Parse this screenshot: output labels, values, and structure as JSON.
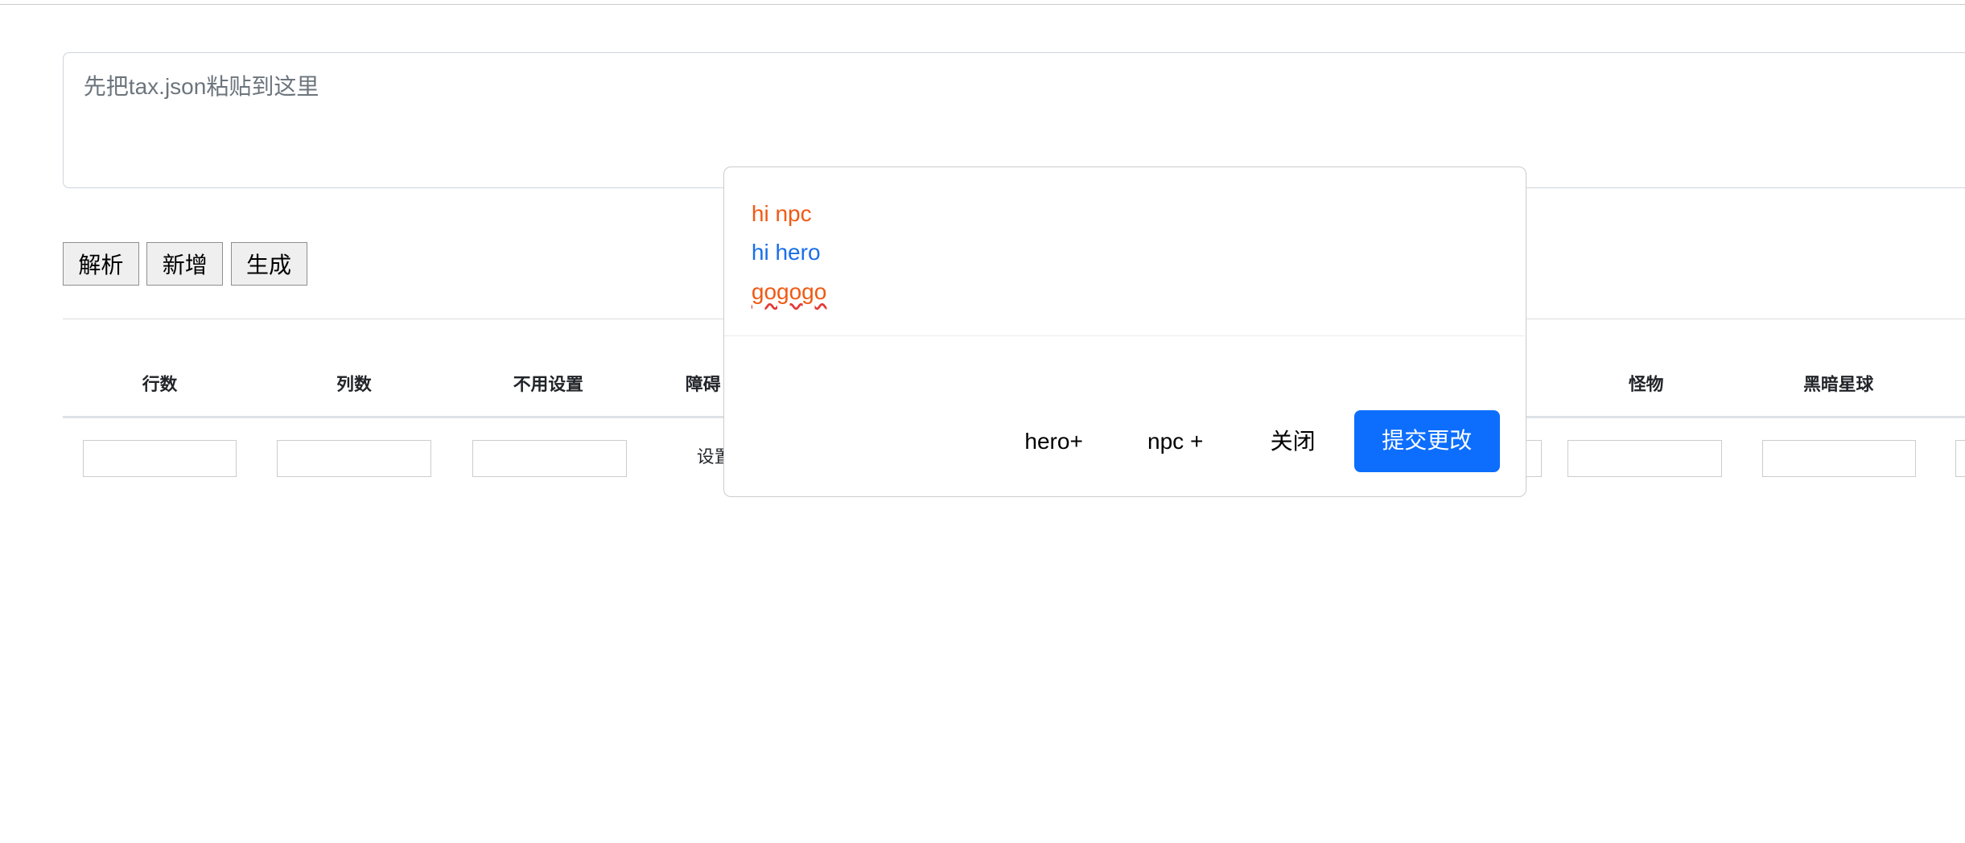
{
  "editor": {
    "placeholder": "先把tax.json粘贴到这里"
  },
  "toolbar": {
    "parse": "解析",
    "add": "新增",
    "generate": "生成"
  },
  "table": {
    "headers": [
      "行数",
      "列数",
      "不用设置",
      "障碍",
      "怪物",
      "黑暗星球"
    ],
    "row": {
      "obstacle_action": "设置"
    }
  },
  "modal": {
    "lines": [
      "hi npc",
      "hi hero",
      "gogogo"
    ],
    "footer": {
      "hero_add": "hero+",
      "npc_add": "npc +",
      "close": "关闭",
      "submit": "提交更改"
    }
  },
  "colors": {
    "primary": "#0d6efd",
    "npc": "#f05a14",
    "hero": "#1a6fe8"
  }
}
